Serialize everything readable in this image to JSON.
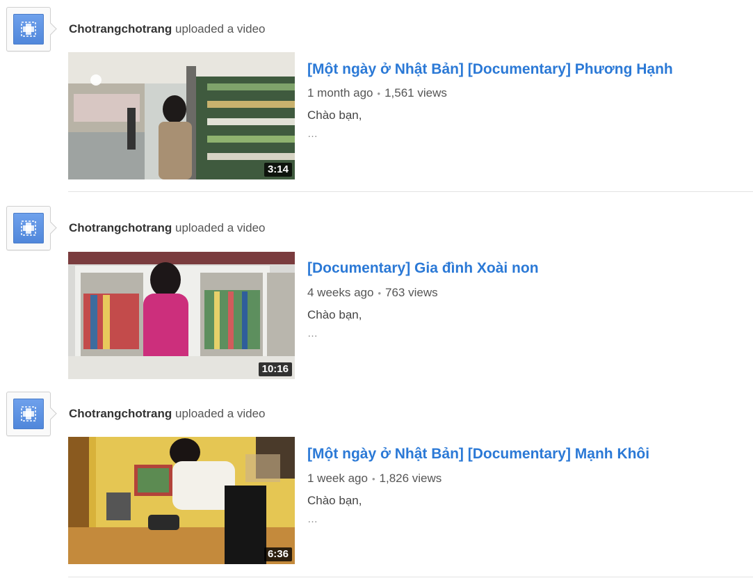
{
  "feed": {
    "items": [
      {
        "channel": "Chotrangchotrang",
        "action": "uploaded a video",
        "title": "[Một ngày ở Nhật Bản] [Documentary] Phương Hạnh",
        "age": "1 month ago",
        "views": "1,561 views",
        "description": "Chào bạn,",
        "ellipsis": "…",
        "duration": "3:14"
      },
      {
        "channel": "Chotrangchotrang",
        "action": "uploaded a video",
        "title": "[Documentary] Gia đình Xoài non",
        "age": "4 weeks ago",
        "views": "763 views",
        "description": "Chào bạn,",
        "ellipsis": "…",
        "duration": "10:16"
      },
      {
        "channel": "Chotrangchotrang",
        "action": "uploaded a video",
        "title": "[Một ngày ở Nhật Bản] [Documentary] Mạnh Khôi",
        "age": "1 week ago",
        "views": "1,826 views",
        "description": "Chào bạn,",
        "ellipsis": "…",
        "duration": "6:36"
      }
    ]
  },
  "colors": {
    "title_link": "#2b79d6",
    "avatar_blue": "#5b8fe0",
    "meta_text": "#555555"
  },
  "icons": {
    "avatar": "default-channel-avatar-icon",
    "separator": "bullet-dot"
  }
}
